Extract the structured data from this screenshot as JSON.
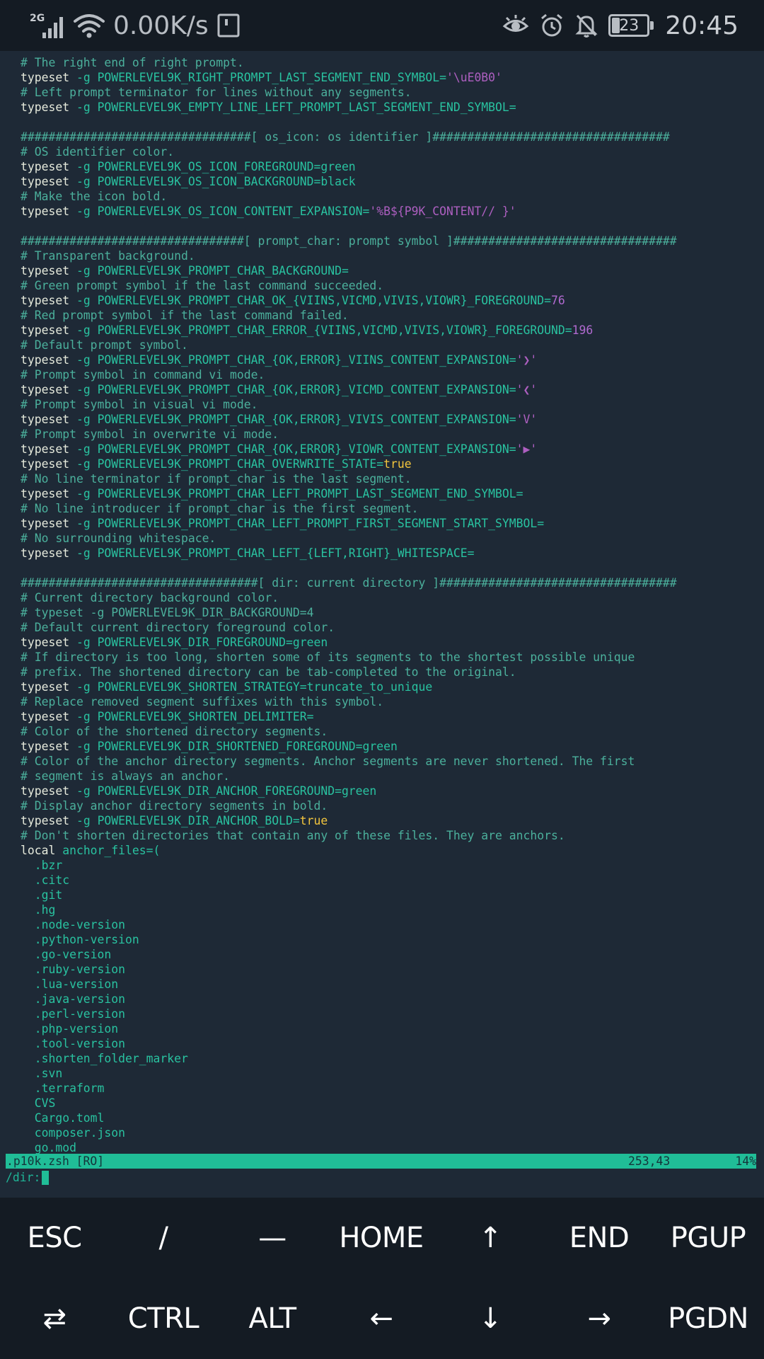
{
  "status_bar": {
    "network_type": "2G",
    "net_speed": "0.00K/s",
    "battery": "23",
    "time": "20:45",
    "icons": [
      "signal-icon",
      "wifi-icon",
      "sim-icon",
      "eye-icon",
      "alarm-icon",
      "bell-off-icon",
      "battery-icon"
    ]
  },
  "editor": {
    "lines": [
      [
        [
          "cmt",
          "# The right end of right prompt."
        ]
      ],
      [
        [
          "kw",
          "typeset"
        ],
        [
          "opt",
          " -g "
        ],
        [
          "ident",
          "POWERLEVEL9K_RIGHT_PROMPT_LAST_SEGMENT_END_SYMBOL="
        ],
        [
          "str",
          "'\\uE0B0'"
        ]
      ],
      [
        [
          "cmt",
          "# Left prompt terminator for lines without any segments."
        ]
      ],
      [
        [
          "kw",
          "typeset"
        ],
        [
          "opt",
          " -g "
        ],
        [
          "ident",
          "POWERLEVEL9K_EMPTY_LINE_LEFT_PROMPT_LAST_SEGMENT_END_SYMBOL="
        ]
      ],
      [],
      [
        [
          "cmt",
          "#################################[ os_icon: os identifier ]##################################"
        ]
      ],
      [
        [
          "cmt",
          "# OS identifier color."
        ]
      ],
      [
        [
          "kw",
          "typeset"
        ],
        [
          "opt",
          " -g "
        ],
        [
          "ident",
          "POWERLEVEL9K_OS_ICON_FOREGROUND=green"
        ]
      ],
      [
        [
          "kw",
          "typeset"
        ],
        [
          "opt",
          " -g "
        ],
        [
          "ident",
          "POWERLEVEL9K_OS_ICON_BACKGROUND=black"
        ]
      ],
      [
        [
          "cmt",
          "# Make the icon bold."
        ]
      ],
      [
        [
          "kw",
          "typeset"
        ],
        [
          "opt",
          " -g "
        ],
        [
          "ident",
          "POWERLEVEL9K_OS_ICON_CONTENT_EXPANSION="
        ],
        [
          "str",
          "'%B${P9K_CONTENT// }'"
        ]
      ],
      [],
      [
        [
          "cmt",
          "################################[ prompt_char: prompt symbol ]################################"
        ]
      ],
      [
        [
          "cmt",
          "# Transparent background."
        ]
      ],
      [
        [
          "kw",
          "typeset"
        ],
        [
          "opt",
          " -g "
        ],
        [
          "ident",
          "POWERLEVEL9K_PROMPT_CHAR_BACKGROUND="
        ]
      ],
      [
        [
          "cmt",
          "# Green prompt symbol if the last command succeeded."
        ]
      ],
      [
        [
          "kw",
          "typeset"
        ],
        [
          "opt",
          " -g "
        ],
        [
          "ident",
          "POWERLEVEL9K_PROMPT_CHAR_OK_{VIINS,VICMD,VIVIS,VIOWR}_FOREGROUND="
        ],
        [
          "num",
          "76"
        ]
      ],
      [
        [
          "cmt",
          "# Red prompt symbol if the last command failed."
        ]
      ],
      [
        [
          "kw",
          "typeset"
        ],
        [
          "opt",
          " -g "
        ],
        [
          "ident",
          "POWERLEVEL9K_PROMPT_CHAR_ERROR_{VIINS,VICMD,VIVIS,VIOWR}_FOREGROUND="
        ],
        [
          "num",
          "196"
        ]
      ],
      [
        [
          "cmt",
          "# Default prompt symbol."
        ]
      ],
      [
        [
          "kw",
          "typeset"
        ],
        [
          "opt",
          " -g "
        ],
        [
          "ident",
          "POWERLEVEL9K_PROMPT_CHAR_{OK,ERROR}_VIINS_CONTENT_EXPANSION="
        ],
        [
          "str",
          "'❯'"
        ]
      ],
      [
        [
          "cmt",
          "# Prompt symbol in command vi mode."
        ]
      ],
      [
        [
          "kw",
          "typeset"
        ],
        [
          "opt",
          " -g "
        ],
        [
          "ident",
          "POWERLEVEL9K_PROMPT_CHAR_{OK,ERROR}_VICMD_CONTENT_EXPANSION="
        ],
        [
          "str",
          "'❮'"
        ]
      ],
      [
        [
          "cmt",
          "# Prompt symbol in visual vi mode."
        ]
      ],
      [
        [
          "kw",
          "typeset"
        ],
        [
          "opt",
          " -g "
        ],
        [
          "ident",
          "POWERLEVEL9K_PROMPT_CHAR_{OK,ERROR}_VIVIS_CONTENT_EXPANSION="
        ],
        [
          "str",
          "'V'"
        ]
      ],
      [
        [
          "cmt",
          "# Prompt symbol in overwrite vi mode."
        ]
      ],
      [
        [
          "kw",
          "typeset"
        ],
        [
          "opt",
          " -g "
        ],
        [
          "ident",
          "POWERLEVEL9K_PROMPT_CHAR_{OK,ERROR}_VIOWR_CONTENT_EXPANSION="
        ],
        [
          "str",
          "'▶'"
        ]
      ],
      [
        [
          "kw",
          "typeset"
        ],
        [
          "opt",
          " -g "
        ],
        [
          "ident",
          "POWERLEVEL9K_PROMPT_CHAR_OVERWRITE_STATE="
        ],
        [
          "bool",
          "true"
        ]
      ],
      [
        [
          "cmt",
          "# No line terminator if prompt_char is the last segment."
        ]
      ],
      [
        [
          "kw",
          "typeset"
        ],
        [
          "opt",
          " -g "
        ],
        [
          "ident",
          "POWERLEVEL9K_PROMPT_CHAR_LEFT_PROMPT_LAST_SEGMENT_END_SYMBOL="
        ]
      ],
      [
        [
          "cmt",
          "# No line introducer if prompt_char is the first segment."
        ]
      ],
      [
        [
          "kw",
          "typeset"
        ],
        [
          "opt",
          " -g "
        ],
        [
          "ident",
          "POWERLEVEL9K_PROMPT_CHAR_LEFT_PROMPT_FIRST_SEGMENT_START_SYMBOL="
        ]
      ],
      [
        [
          "cmt",
          "# No surrounding whitespace."
        ]
      ],
      [
        [
          "kw",
          "typeset"
        ],
        [
          "opt",
          " -g "
        ],
        [
          "ident",
          "POWERLEVEL9K_PROMPT_CHAR_LEFT_{LEFT,RIGHT}_WHITESPACE="
        ]
      ],
      [],
      [
        [
          "cmt",
          "##################################[ dir: current directory ]##################################"
        ]
      ],
      [
        [
          "cmt",
          "# Current directory background color."
        ]
      ],
      [
        [
          "cmt",
          "# typeset -g POWERLEVEL9K_DIR_BACKGROUND=4"
        ]
      ],
      [
        [
          "cmt",
          "# Default current directory foreground color."
        ]
      ],
      [
        [
          "kw",
          "typeset"
        ],
        [
          "opt",
          " -g "
        ],
        [
          "ident",
          "POWERLEVEL9K_DIR_FOREGROUND=green"
        ]
      ],
      [
        [
          "cmt",
          "# If directory is too long, shorten some of its segments to the shortest possible unique"
        ]
      ],
      [
        [
          "cmt",
          "# prefix. The shortened directory can be tab-completed to the original."
        ]
      ],
      [
        [
          "kw",
          "typeset"
        ],
        [
          "opt",
          " -g "
        ],
        [
          "ident",
          "POWERLEVEL9K_SHORTEN_STRATEGY=truncate_to_unique"
        ]
      ],
      [
        [
          "cmt",
          "# Replace removed segment suffixes with this symbol."
        ]
      ],
      [
        [
          "kw",
          "typeset"
        ],
        [
          "opt",
          " -g "
        ],
        [
          "ident",
          "POWERLEVEL9K_SHORTEN_DELIMITER="
        ]
      ],
      [
        [
          "cmt",
          "# Color of the shortened directory segments."
        ]
      ],
      [
        [
          "kw",
          "typeset"
        ],
        [
          "opt",
          " -g "
        ],
        [
          "ident",
          "POWERLEVEL9K_DIR_SHORTENED_FOREGROUND=green"
        ]
      ],
      [
        [
          "cmt",
          "# Color of the anchor directory segments. Anchor segments are never shortened. The first"
        ]
      ],
      [
        [
          "cmt",
          "# segment is always an anchor."
        ]
      ],
      [
        [
          "kw",
          "typeset"
        ],
        [
          "opt",
          " -g "
        ],
        [
          "ident",
          "POWERLEVEL9K_DIR_ANCHOR_FOREGROUND=green"
        ]
      ],
      [
        [
          "cmt",
          "# Display anchor directory segments in bold."
        ]
      ],
      [
        [
          "kw",
          "typeset"
        ],
        [
          "opt",
          " -g "
        ],
        [
          "ident",
          "POWERLEVEL9K_DIR_ANCHOR_BOLD="
        ],
        [
          "bool",
          "true"
        ]
      ],
      [
        [
          "cmt",
          "# Don't shorten directories that contain any of these files. They are anchors."
        ]
      ],
      [
        [
          "kw",
          "local"
        ],
        [
          "ident",
          " anchor_files=("
        ]
      ],
      [
        [
          "ident",
          "  .bzr"
        ]
      ],
      [
        [
          "ident",
          "  .citc"
        ]
      ],
      [
        [
          "ident",
          "  .git"
        ]
      ],
      [
        [
          "ident",
          "  .hg"
        ]
      ],
      [
        [
          "ident",
          "  .node-version"
        ]
      ],
      [
        [
          "ident",
          "  .python-version"
        ]
      ],
      [
        [
          "ident",
          "  .go-version"
        ]
      ],
      [
        [
          "ident",
          "  .ruby-version"
        ]
      ],
      [
        [
          "ident",
          "  .lua-version"
        ]
      ],
      [
        [
          "ident",
          "  .java-version"
        ]
      ],
      [
        [
          "ident",
          "  .perl-version"
        ]
      ],
      [
        [
          "ident",
          "  .php-version"
        ]
      ],
      [
        [
          "ident",
          "  .tool-version"
        ]
      ],
      [
        [
          "ident",
          "  .shorten_folder_marker"
        ]
      ],
      [
        [
          "ident",
          "  .svn"
        ]
      ],
      [
        [
          "ident",
          "  .terraform"
        ]
      ],
      [
        [
          "ident",
          "  CVS"
        ]
      ],
      [
        [
          "ident",
          "  Cargo.toml"
        ]
      ],
      [
        [
          "ident",
          "  composer.json"
        ]
      ],
      [
        [
          "ident",
          "  go.mod"
        ]
      ]
    ],
    "status_line": {
      "file": ".p10k.zsh [RO]",
      "position": "253,43",
      "percent": "14%"
    },
    "command_line": "/dir:"
  },
  "extra_keys": {
    "row1": [
      "ESC",
      "/",
      "—",
      "HOME",
      "↑",
      "END",
      "PGUP"
    ],
    "row2": [
      "⇄",
      "CTRL",
      "ALT",
      "←",
      "↓",
      "→",
      "PGDN"
    ]
  },
  "colors": {
    "terminal_bg": "#1e2936",
    "status_line_bg": "#20bd97",
    "keys_bg": "#141b23",
    "comment": "#4bb09c",
    "keyword": "#e6eadc",
    "string": "#ad5fc0",
    "bool": "#f2c53d"
  }
}
